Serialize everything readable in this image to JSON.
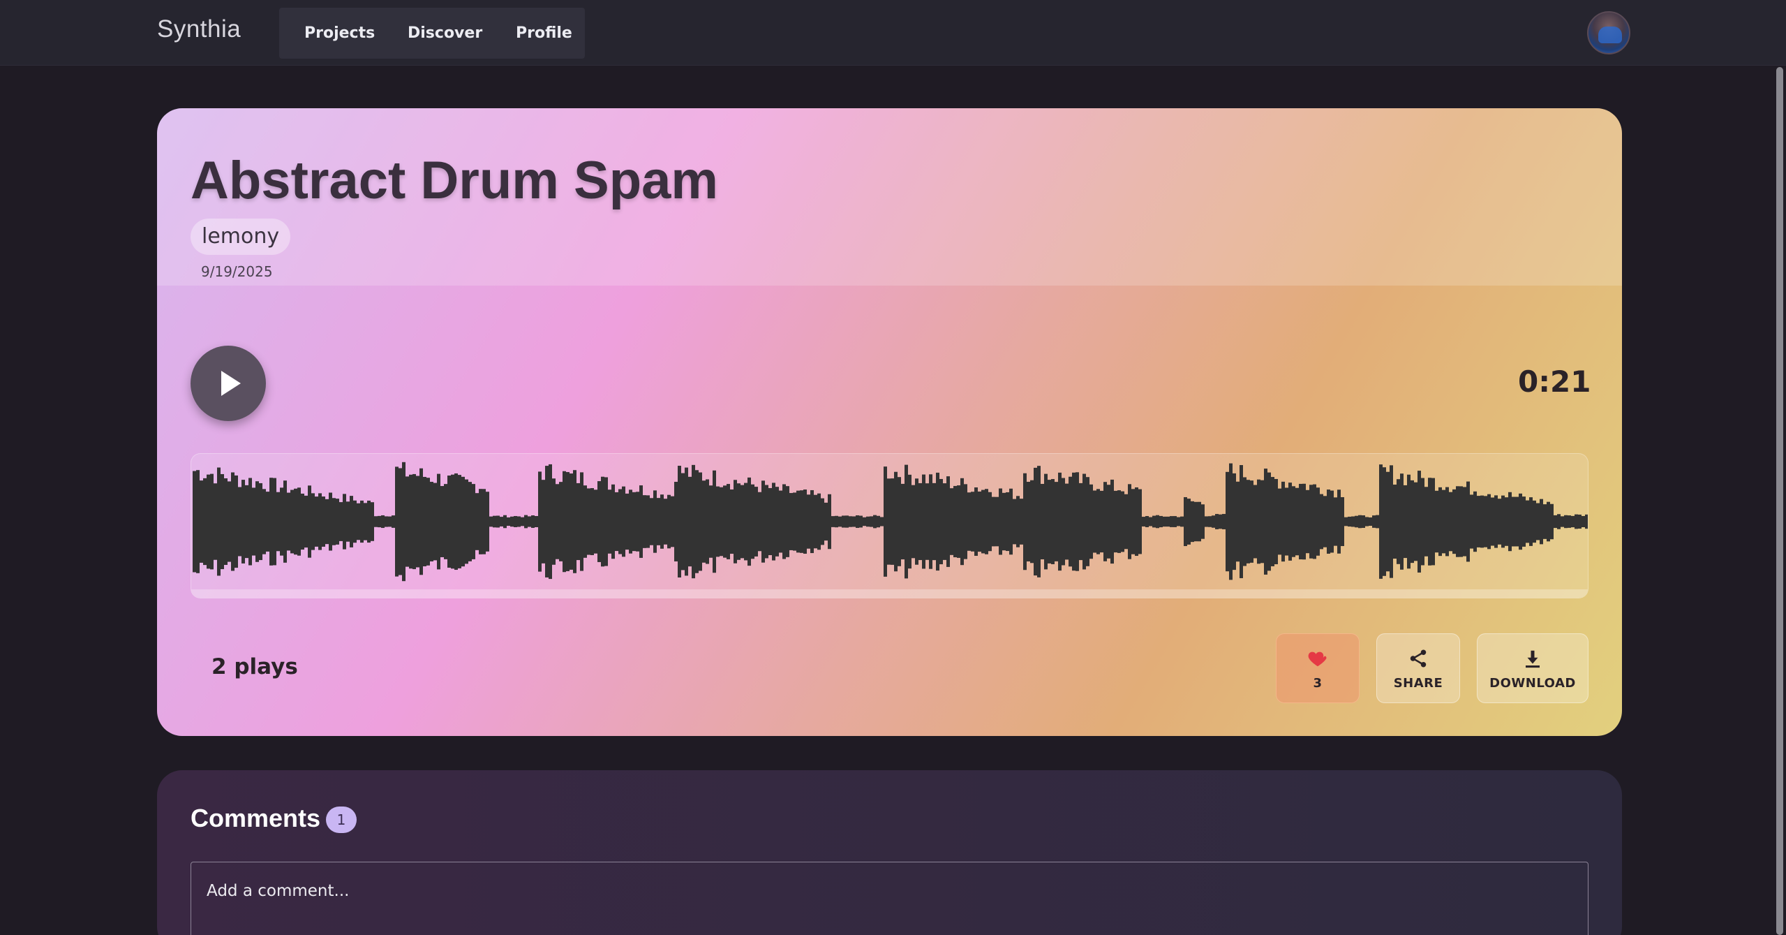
{
  "header": {
    "brand": "Synthia",
    "nav": [
      {
        "label": "Projects"
      },
      {
        "label": "Discover"
      },
      {
        "label": "Profile"
      }
    ],
    "avatar_icon": "user-avatar"
  },
  "track": {
    "title": "Abstract Drum Spam",
    "artist": "lemony",
    "date": "9/19/2025",
    "duration": "0:21",
    "plays": "2 plays",
    "progress_fraction": 0,
    "play_icon": "play-icon",
    "actions": {
      "like_count": "3",
      "like_icon": "heart-icon",
      "like_color": "#e53945",
      "share_label": "SHARE",
      "share_icon": "share-icon",
      "download_label": "DOWNLOAD",
      "download_icon": "download-icon"
    },
    "waveform_color": "#333333"
  },
  "comments": {
    "title": "Comments",
    "count": "1",
    "input_placeholder": "Add a comment..."
  }
}
